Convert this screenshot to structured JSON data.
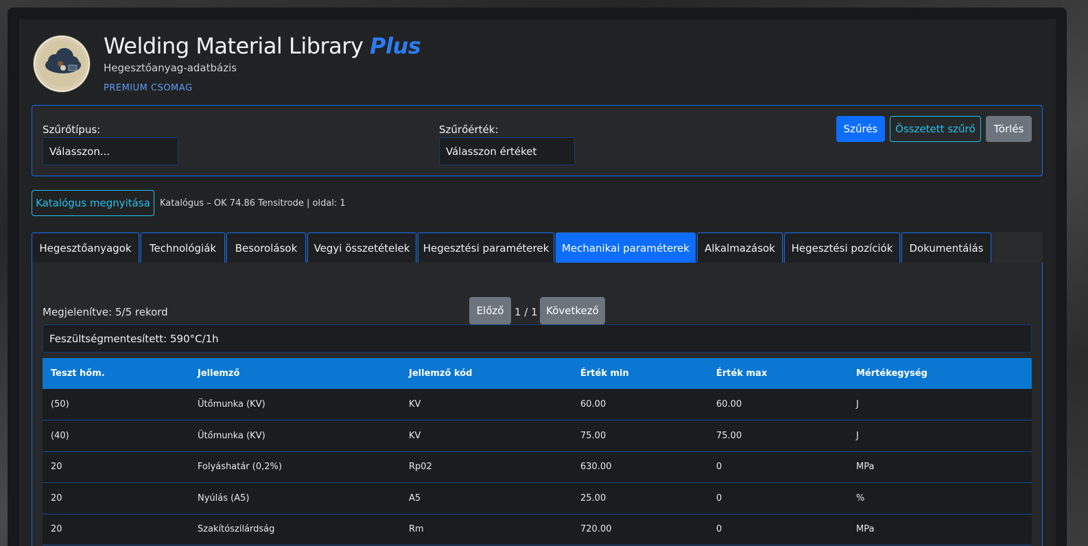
{
  "header": {
    "title": "Welding Material Library",
    "title_accent": "Plus",
    "subtitle": "Hegesztőanyag-adatbázis",
    "badge": "PREMIUM CSOMAG"
  },
  "filter": {
    "type_label": "Szűrőtípus:",
    "type_value": "Válasszon...",
    "value_label": "Szűrőérték:",
    "value_value": "Válasszon értéket",
    "filter_button": "Szűrés",
    "complex_button": "Összetett szűrő",
    "clear_button": "Törlés"
  },
  "catalog": {
    "open_button": "Katalógus megnyitása",
    "info": "Katalógus – OK 74.86 Tensitrode | oldal: 1"
  },
  "tabs": [
    {
      "label": "Hegesztőanyagok"
    },
    {
      "label": "Technológiák"
    },
    {
      "label": "Besorolások"
    },
    {
      "label": "Vegyi összetételek"
    },
    {
      "label": "Hegesztési paraméterek"
    },
    {
      "label": "Mechanikai paraméterek",
      "active": true
    },
    {
      "label": "Alkalmazások"
    },
    {
      "label": "Hegesztési pozíciók"
    },
    {
      "label": "Dokumentálás"
    }
  ],
  "main": {
    "shown": "Megjelenítve: 5/5 rekord",
    "prev_button": "Előző",
    "page": "1 / 1",
    "next_button": "Következő",
    "heat_treatment": "Feszültségmentesített: 590°C/1h"
  },
  "table": {
    "columns": [
      "Teszt hőm.",
      "Jellemző",
      "Jellemző kód",
      "Érték min",
      "Érték max",
      "Mértékegység"
    ],
    "rows": [
      [
        "(50)",
        "Ütőmunka (KV)",
        "KV",
        "60.00",
        "60.00",
        "J"
      ],
      [
        "(40)",
        "Ütőmunka (KV)",
        "KV",
        "75.00",
        "75.00",
        "J"
      ],
      [
        "20",
        "Folyáshatár (0,2%)",
        "Rp02",
        "630.00",
        "0",
        "MPa"
      ],
      [
        "20",
        "Nyúlás (A5)",
        "A5",
        "25.00",
        "0",
        "%"
      ],
      [
        "20",
        "Szakítószilárdság",
        "Rm",
        "720.00",
        "0",
        "MPa"
      ]
    ]
  },
  "colors": {
    "accent": "#0d6efd",
    "header_row": "#0a78d2",
    "outline": "#22c1ec",
    "secondary": "#6c757d"
  },
  "icons": [
    "cloud-logo-icon"
  ]
}
